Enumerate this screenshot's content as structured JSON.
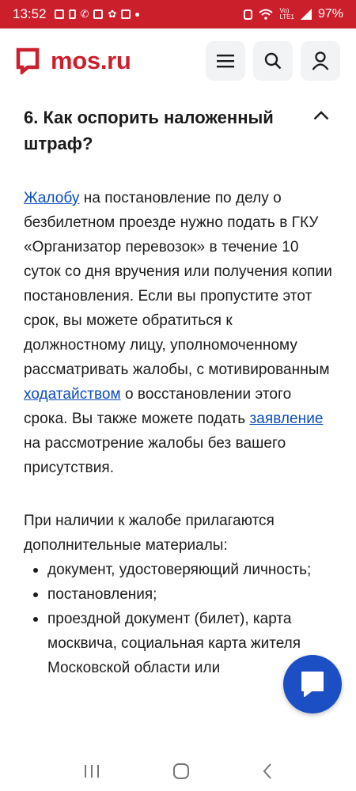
{
  "status_bar": {
    "time": "13:52",
    "net_top": "Vo)",
    "net_bottom": "LTE1",
    "battery": "97%"
  },
  "header": {
    "logo_text": "mos.ru",
    "accent_color": "#cc1f2c"
  },
  "section": {
    "title": "6. Как оспорить наложенный штраф?"
  },
  "paragraph1": {
    "link1": "Жалобу",
    "text1": " на постановление по делу о безбилетном проезде нужно подать в ГКУ «Организатор перевозок» в течение 10 суток со дня вручения или получения копии постановления. Если вы пропустите этот срок, вы можете обратиться к должностному лицу, уполномоченному рассматривать жалобы, с мотивированным ",
    "link2": "ходатайством",
    "text2": " о восстановлении этого срока. Вы также можете подать ",
    "link3": "заявление",
    "text3": " на рассмотрение жалобы без вашего присутствия."
  },
  "paragraph2": {
    "text": "При наличии к жалобе прилагаются дополнительные материалы:"
  },
  "materials": [
    "документ, удостоверяющий личность;",
    "постановления;",
    "проездной документ (билет), карта москвича, социальная карта жителя Московской области или"
  ]
}
